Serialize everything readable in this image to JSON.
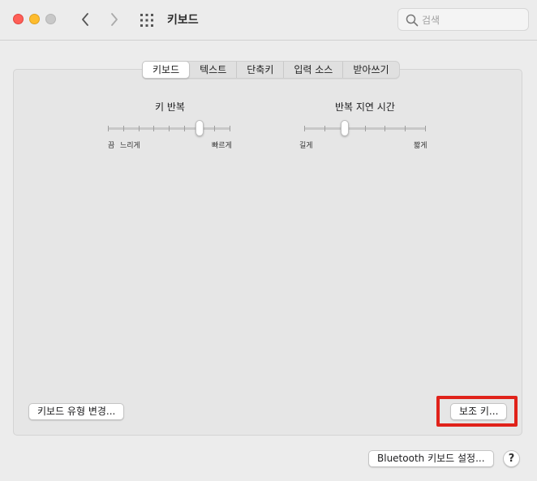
{
  "window": {
    "title": "키보드",
    "search_placeholder": "검색"
  },
  "tabs": [
    {
      "label": "키보드",
      "active": true
    },
    {
      "label": "텍스트",
      "active": false
    },
    {
      "label": "단축키",
      "active": false
    },
    {
      "label": "입력 소스",
      "active": false
    },
    {
      "label": "받아쓰기",
      "active": false
    }
  ],
  "key_repeat": {
    "title": "키 반복",
    "labels": [
      "끔",
      "느리게",
      "빠르게"
    ],
    "value_step": 6,
    "steps": 8
  },
  "repeat_delay": {
    "title": "반복 지연 시간",
    "labels": [
      "길게",
      "짧게"
    ],
    "value_step": 2,
    "steps": 6
  },
  "buttons": {
    "change_layout": "키보드 유형 변경...",
    "modifier_keys": "보조 키...",
    "bluetooth": "Bluetooth 키보드 설정...",
    "help": "?"
  },
  "colors": {
    "highlight": "#e0221a",
    "close": "#ff5f57",
    "minimize": "#febc2e"
  },
  "icons": [
    "back-arrow-icon",
    "forward-arrow-icon",
    "grid-icon",
    "search-icon"
  ]
}
